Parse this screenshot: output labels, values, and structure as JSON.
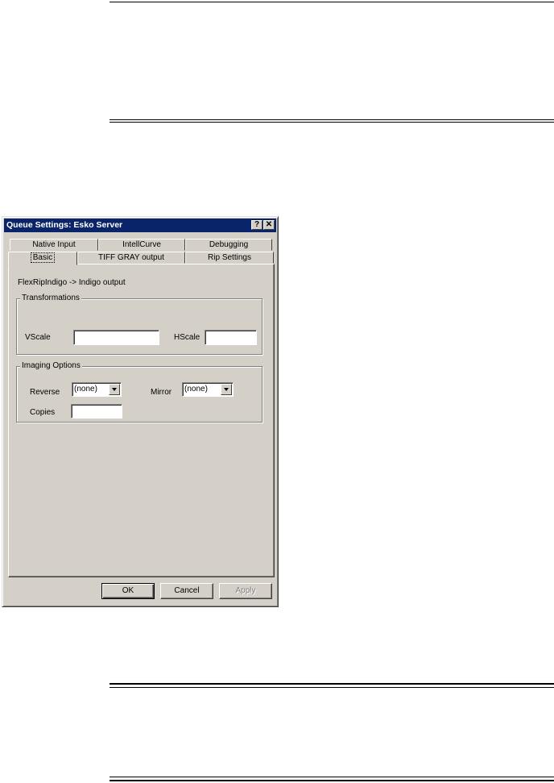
{
  "dialog": {
    "title": "Queue Settings: Esko Server",
    "help_glyph": "?",
    "close_glyph": "✕"
  },
  "tabs": {
    "row1": [
      "Native Input",
      "IntellCurve",
      "Debugging"
    ],
    "row2": [
      "Basic",
      "TIFF GRAY output",
      "Rip Settings"
    ],
    "active": "Basic"
  },
  "basic": {
    "subtitle": "FlexRipIndigo -> Indigo output",
    "transformations": {
      "legend": "Transformations",
      "vscale_label": "VScale",
      "vscale_value": "",
      "hscale_label": "HScale",
      "hscale_value": ""
    },
    "imaging": {
      "legend": "Imaging Options",
      "reverse_label": "Reverse",
      "reverse_value": "(none)",
      "mirror_label": "Mirror",
      "mirror_value": "(none)",
      "copies_label": "Copies",
      "copies_value": ""
    }
  },
  "buttons": {
    "ok": "OK",
    "cancel": "Cancel",
    "apply": "Apply"
  }
}
